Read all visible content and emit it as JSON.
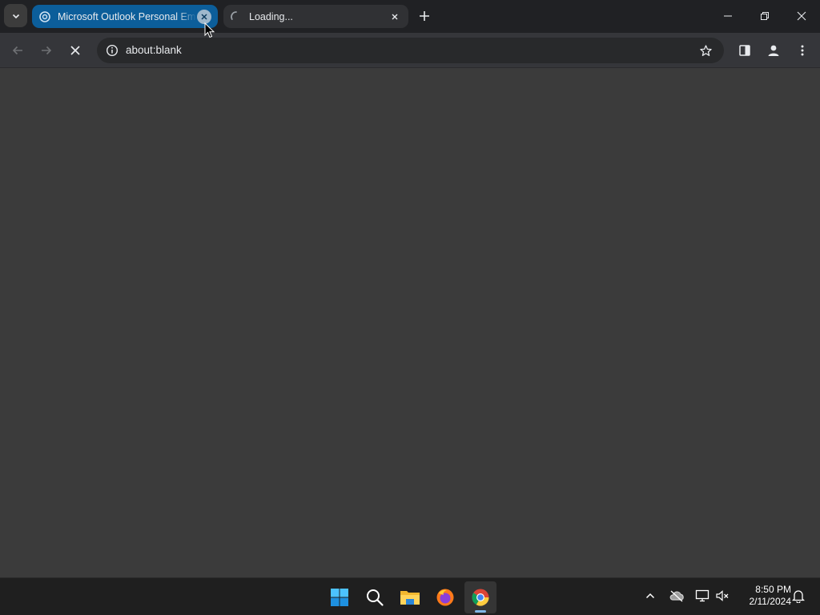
{
  "tabs": [
    {
      "title": "Microsoft Outlook Personal Email",
      "active": false,
      "close_icon": "close-icon"
    },
    {
      "title": "Loading...",
      "active": true,
      "close_icon": "close-icon"
    }
  ],
  "toolbar": {
    "url": "about:blank",
    "back_icon": "arrow-left-icon",
    "forward_icon": "arrow-right-icon",
    "stop_icon": "close-icon",
    "info_icon": "info-icon",
    "bookmark_icon": "star-icon",
    "side_panel_icon": "side-panel-icon",
    "profile_icon": "profile-icon",
    "menu_icon": "kebab-menu-icon"
  },
  "window": {
    "minimize_icon": "minimize-icon",
    "restore_icon": "restore-icon",
    "close_icon": "close-icon"
  },
  "taskbar": {
    "apps": [
      "Start",
      "Search",
      "File Explorer",
      "Firefox",
      "Chrome"
    ],
    "time": "8:50 PM",
    "date": "2/11/2024"
  },
  "colors": {
    "tab_strip": "#202124",
    "active_group_tab": "#0c5e9a",
    "toolbar": "#35363a",
    "content": "#3b3b3b",
    "taskbar": "#1f1f1f"
  }
}
